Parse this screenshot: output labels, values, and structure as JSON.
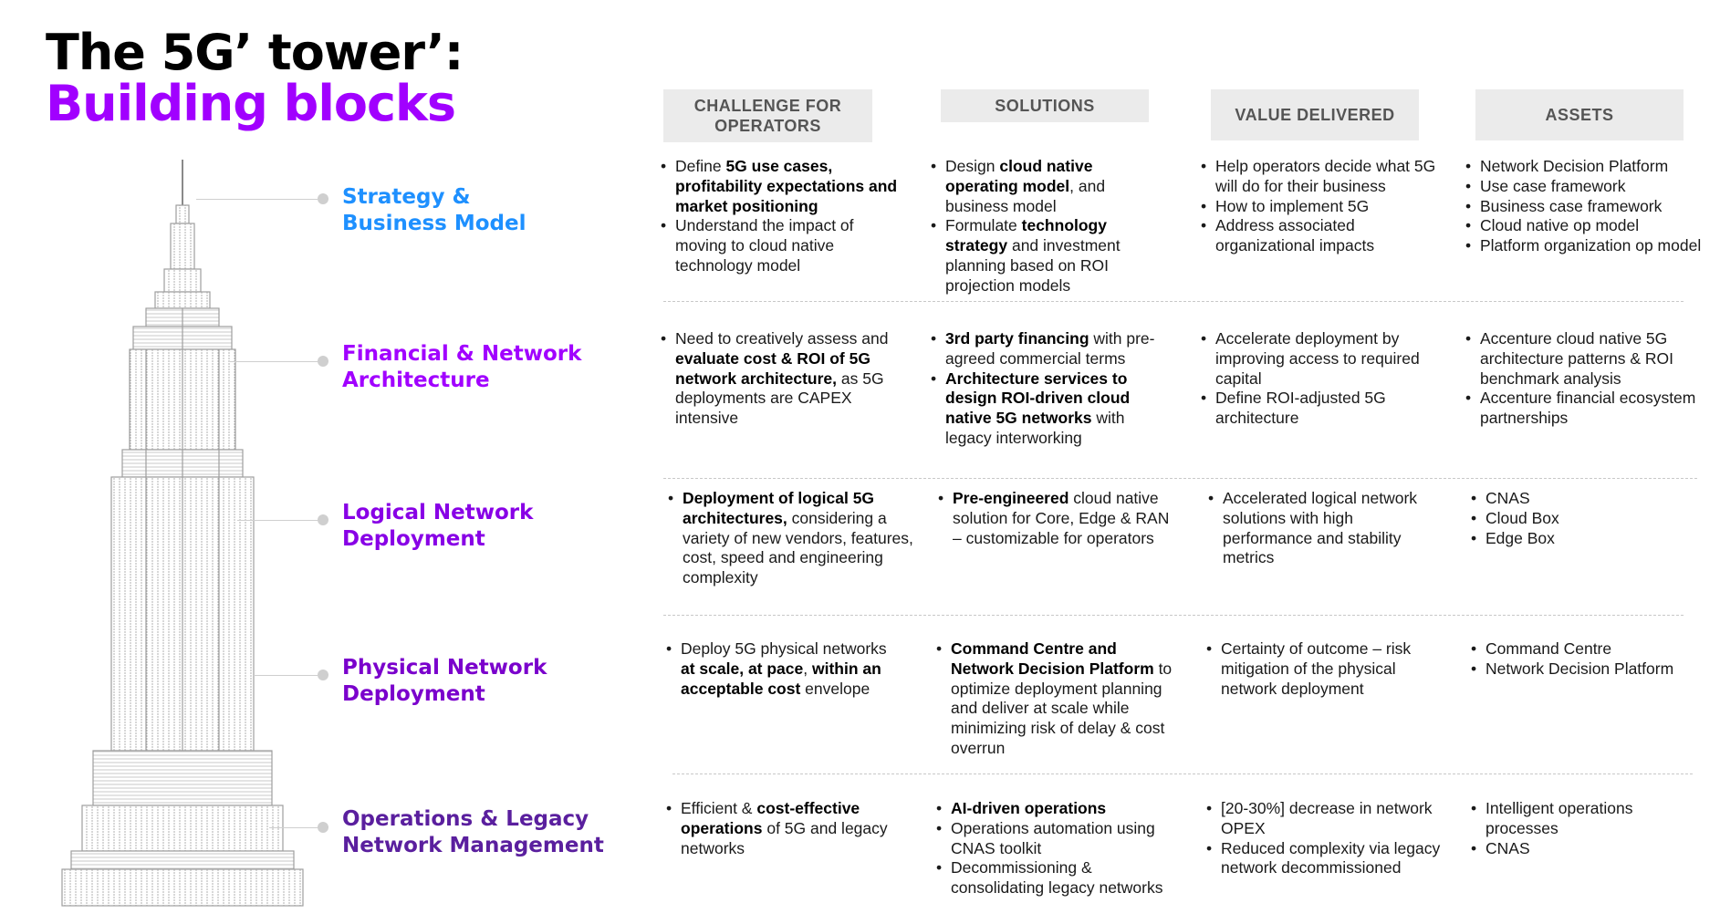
{
  "title": {
    "line1": "The 5G’ tower’:",
    "line2": "Building blocks"
  },
  "colors": {
    "accent": "#a100ff",
    "strategy": "#1e90ff",
    "financial": "#a100ff",
    "logical": "#8800e6",
    "physical": "#7a00cc",
    "operations": "#5a1f9e",
    "header_bg": "#ebebeb",
    "header_text": "#555555"
  },
  "columns": [
    "CHALLENGE FOR OPERATORS",
    "SOLUTIONS",
    "VALUE DELIVERED",
    "ASSETS"
  ],
  "rows": [
    {
      "label": "Strategy & Business Model",
      "challenge": [
        [
          {
            "t": "Define "
          },
          {
            "t": "5G use cases, profitability expectations and market positioning",
            "b": true
          }
        ],
        [
          {
            "t": "Understand the impact of moving to cloud native technology model"
          }
        ]
      ],
      "solutions": [
        [
          {
            "t": "Design "
          },
          {
            "t": "cloud native operating model",
            "b": true
          },
          {
            "t": ", and business model"
          }
        ],
        [
          {
            "t": "Formulate "
          },
          {
            "t": "technology strategy",
            "b": true
          },
          {
            "t": " and investment planning based on ROI projection models"
          }
        ]
      ],
      "value": [
        [
          {
            "t": "Help operators decide what 5G will do for their business"
          }
        ],
        [
          {
            "t": "How to implement 5G"
          }
        ],
        [
          {
            "t": "Address associated organizational impacts"
          }
        ]
      ],
      "assets": [
        [
          {
            "t": "Network Decision Platform"
          }
        ],
        [
          {
            "t": "Use case framework"
          }
        ],
        [
          {
            "t": "Business case framework"
          }
        ],
        [
          {
            "t": "Cloud native op model"
          }
        ],
        [
          {
            "t": "Platform organization op model"
          }
        ]
      ]
    },
    {
      "label": "Financial & Network Architecture",
      "challenge": [
        [
          {
            "t": "Need to creatively assess and "
          },
          {
            "t": "evaluate cost & ROI of 5G network architecture,",
            "b": true
          },
          {
            "t": " as 5G deployments are CAPEX intensive"
          }
        ]
      ],
      "solutions": [
        [
          {
            "t": "3rd party financing",
            "b": true
          },
          {
            "t": " with pre-agreed commercial terms"
          }
        ],
        [
          {
            "t": "Architecture services to design ROI-driven cloud native 5G networks",
            "b": true
          },
          {
            "t": " with legacy interworking"
          }
        ]
      ],
      "value": [
        [
          {
            "t": "Accelerate deployment by improving access to required capital"
          }
        ],
        [
          {
            "t": "Define ROI-adjusted 5G architecture"
          }
        ]
      ],
      "assets": [
        [
          {
            "t": "Accenture cloud native 5G architecture patterns & ROI benchmark analysis"
          }
        ],
        [
          {
            "t": "Accenture financial ecosystem partnerships"
          }
        ]
      ]
    },
    {
      "label": "Logical Network Deployment",
      "challenge": [
        [
          {
            "t": "Deployment of logical 5G architectures,",
            "b": true
          },
          {
            "t": " considering a variety of new vendors, features, cost, speed and engineering complexity"
          }
        ]
      ],
      "solutions": [
        [
          {
            "t": "Pre-engineered",
            "b": true
          },
          {
            "t": " cloud native solution for Core, Edge & RAN – customizable for operators"
          }
        ]
      ],
      "value": [
        [
          {
            "t": "Accelerated logical network solutions with high performance and stability metrics"
          }
        ]
      ],
      "assets": [
        [
          {
            "t": "CNAS"
          }
        ],
        [
          {
            "t": "Cloud Box"
          }
        ],
        [
          {
            "t": "Edge Box"
          }
        ]
      ]
    },
    {
      "label": "Physical Network Deployment",
      "challenge": [
        [
          {
            "t": "Deploy 5G physical networks "
          },
          {
            "t": "at scale, at pace",
            "b": true
          },
          {
            "t": ", "
          },
          {
            "t": "within an acceptable cost",
            "b": true
          },
          {
            "t": " envelope"
          }
        ]
      ],
      "solutions": [
        [
          {
            "t": "Command Centre and Network Decision Platform",
            "b": true
          },
          {
            "t": " to optimize deployment planning and deliver at scale while minimizing risk of delay & cost overrun"
          }
        ]
      ],
      "value": [
        [
          {
            "t": "Certainty of outcome – risk mitigation of the physical network deployment"
          }
        ]
      ],
      "assets": [
        [
          {
            "t": "Command Centre"
          }
        ],
        [
          {
            "t": "Network Decision Platform"
          }
        ]
      ]
    },
    {
      "label": "Operations & Legacy Network Management",
      "challenge": [
        [
          {
            "t": "Efficient & "
          },
          {
            "t": "cost-effective operations",
            "b": true
          },
          {
            "t": " of 5G and legacy networks"
          }
        ]
      ],
      "solutions": [
        [
          {
            "t": "AI-driven operations",
            "b": true
          }
        ],
        [
          {
            "t": "Operations automation using CNAS toolkit"
          }
        ],
        [
          {
            "t": "Decommissioning & consolidating legacy networks"
          }
        ]
      ],
      "value": [
        [
          {
            "t": "[20-30%] decrease in network OPEX"
          }
        ],
        [
          {
            "t": "Reduced complexity via legacy network decommissioned"
          }
        ]
      ],
      "assets": [
        [
          {
            "t": "Intelligent operations processes"
          }
        ],
        [
          {
            "t": "CNAS"
          }
        ]
      ]
    }
  ]
}
